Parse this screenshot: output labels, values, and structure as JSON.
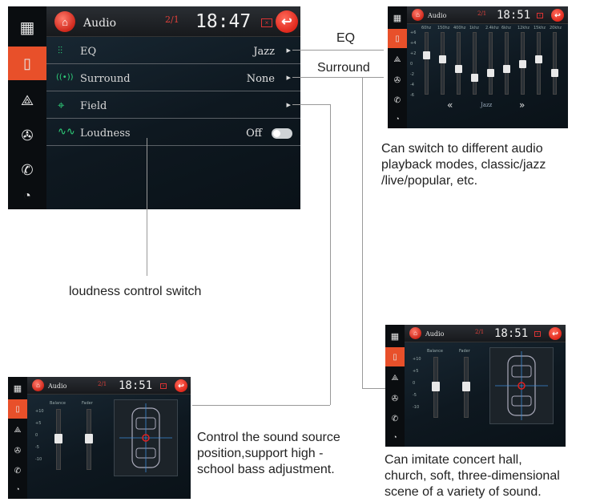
{
  "window": {
    "title": "Audio"
  },
  "main_screen": {
    "title": "Audio",
    "page": "2/1",
    "time": "18:47",
    "rows": [
      {
        "icon": "eq-icon",
        "label": "EQ",
        "value": "Jazz"
      },
      {
        "icon": "surround-icon",
        "label": "Surround",
        "value": "None"
      },
      {
        "icon": "field-icon",
        "label": "Field",
        "value": ""
      },
      {
        "icon": "loudness-icon",
        "label": "Loudness",
        "value": "Off"
      }
    ]
  },
  "eq_screen": {
    "title": "Audio",
    "page": "2/1",
    "time": "18:51",
    "preset": "Jazz",
    "prev": "«",
    "next": "»",
    "freqs": [
      "60hz",
      "150hz",
      "400hz",
      "1khz",
      "2.4khz",
      "6khz",
      "12khz",
      "15khz",
      "20khz"
    ],
    "levels": [
      2,
      1,
      -1,
      -3,
      -2,
      -1,
      0,
      1,
      -2
    ],
    "scale": [
      "+6",
      "+4",
      "+2",
      "0",
      "-2",
      "-4",
      "-6"
    ]
  },
  "field_screen_right": {
    "title": "Audio",
    "page": "2/1",
    "time": "18:51",
    "balance_label": "Balance",
    "fader_label": "Fader",
    "scale": [
      "+10",
      "+5",
      "0",
      "-5",
      "-10"
    ]
  },
  "field_screen_left": {
    "title": "Audio",
    "page": "2/1",
    "time": "18:51",
    "balance_label": "Balance",
    "fader_label": "Fader",
    "scale": [
      "+10",
      "+5",
      "0",
      "-5",
      "-10"
    ]
  },
  "callouts": {
    "eq": "EQ",
    "surround": "Surround",
    "eq_desc": [
      "Can switch to different audio",
      "playback modes, classic/jazz",
      "/live/popular, etc."
    ],
    "loudness_desc": "loudness control switch",
    "field_desc": [
      "Control the sound source",
      "position,support high -",
      "school bass adjustment."
    ],
    "surround_desc": [
      "Can imitate concert hall,",
      "church, soft, three-dimensional",
      "scene of a variety of sound."
    ]
  },
  "colors": {
    "accent": "#e8502a",
    "green": "#2fd07a",
    "red": "#e0281c"
  }
}
